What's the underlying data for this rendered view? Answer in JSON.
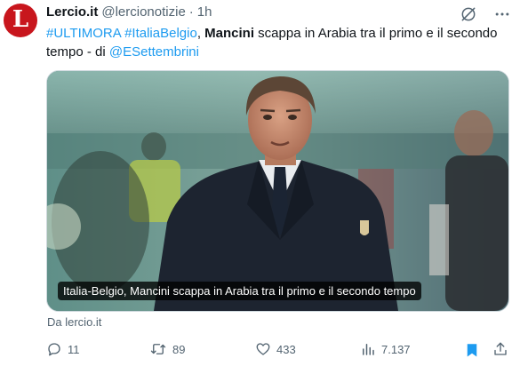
{
  "author": {
    "logo_letter": "L",
    "name": "Lercio.it",
    "handle": "@lercionotizie",
    "separator": "·",
    "time": "1h"
  },
  "tweet": {
    "hashtag1": "#ULTIMORA",
    "hashtag2": "#ItaliaBelgio",
    "comma": ",",
    "bold_name": "Mancini",
    "text_rest": " scappa in Arabia tra il primo e il secondo tempo - di ",
    "mention": "@ESettembrini"
  },
  "card": {
    "caption": "Italia-Belgio, Mancini scappa in Arabia tra il primo e il secondo tempo",
    "source": "Da lercio.it"
  },
  "actions": {
    "replies": "11",
    "retweets": "89",
    "likes": "433",
    "views": "7.137"
  },
  "colors": {
    "accent": "#1d9bf0",
    "muted": "#536471",
    "logo": "#c8161d"
  },
  "icons": [
    "logo-icon",
    "mute-icon",
    "more-icon",
    "reply-icon",
    "retweet-icon",
    "like-icon",
    "views-icon",
    "bookmark-icon",
    "share-icon"
  ]
}
